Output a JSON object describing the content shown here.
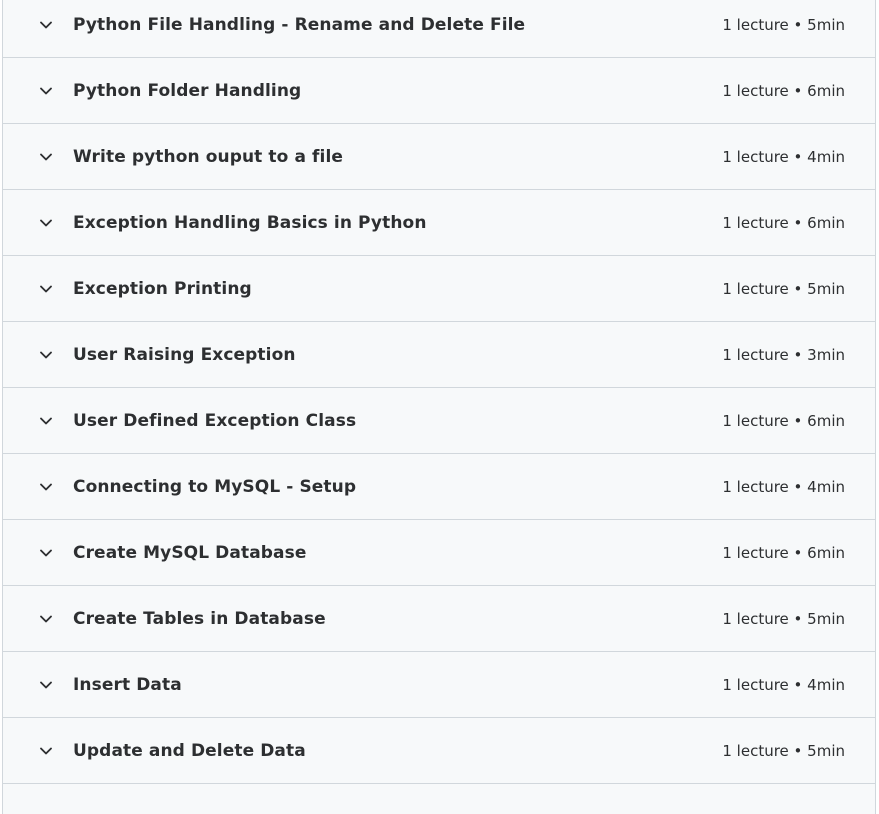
{
  "sections": [
    {
      "title": "Python File Handling - Rename and Delete File",
      "meta": "1 lecture • 5min",
      "icon": "chevron-down-icon"
    },
    {
      "title": "Python Folder Handling",
      "meta": "1 lecture • 6min",
      "icon": "chevron-down-icon"
    },
    {
      "title": "Write python ouput to a file",
      "meta": "1 lecture • 4min",
      "icon": "chevron-down-icon"
    },
    {
      "title": "Exception Handling Basics in Python",
      "meta": "1 lecture • 6min",
      "icon": "chevron-down-icon"
    },
    {
      "title": "Exception Printing",
      "meta": "1 lecture • 5min",
      "icon": "chevron-down-icon"
    },
    {
      "title": "User Raising Exception",
      "meta": "1 lecture • 3min",
      "icon": "chevron-down-icon"
    },
    {
      "title": "User Defined Exception Class",
      "meta": "1 lecture • 6min",
      "icon": "chevron-down-icon"
    },
    {
      "title": "Connecting to MySQL - Setup",
      "meta": "1 lecture • 4min",
      "icon": "chevron-down-icon"
    },
    {
      "title": "Create MySQL Database",
      "meta": "1 lecture • 6min",
      "icon": "chevron-down-icon"
    },
    {
      "title": "Create Tables in Database",
      "meta": "1 lecture • 5min",
      "icon": "chevron-down-icon"
    },
    {
      "title": "Insert Data",
      "meta": "1 lecture • 4min",
      "icon": "chevron-down-icon"
    },
    {
      "title": "Update and Delete Data",
      "meta": "1 lecture • 5min",
      "icon": "chevron-down-icon"
    }
  ],
  "colors": {
    "section_bg": "#f7f9fa",
    "border": "#d1d7dc",
    "text": "#2d2f31"
  }
}
